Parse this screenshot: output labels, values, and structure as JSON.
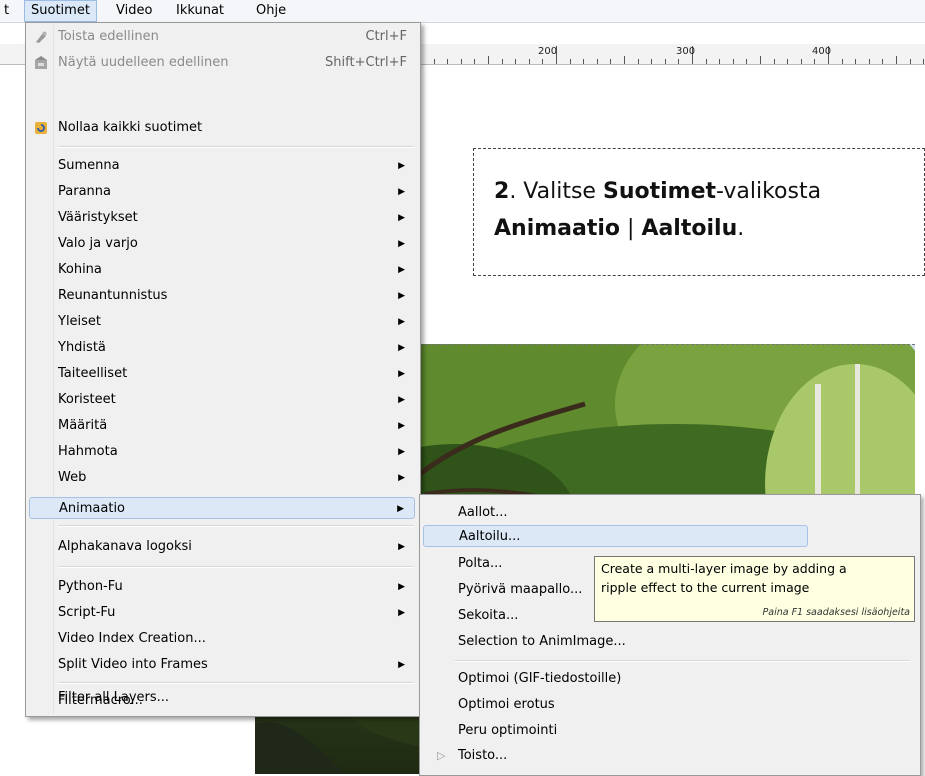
{
  "menubar": {
    "items": [
      {
        "label": "t"
      },
      {
        "label": "Suotimet"
      },
      {
        "label": "Video"
      },
      {
        "label": "Ikkunat"
      },
      {
        "label": "Ohje"
      }
    ]
  },
  "ruler": {
    "labels": [
      "200",
      "300",
      "400"
    ]
  },
  "callout": {
    "step": "2",
    "t1": ". Valitse ",
    "b1": "Suotimet",
    "t2": "-valikosta",
    "b2": "Animaatio",
    "sep": " | ",
    "b3": "Aaltoilu",
    "end": "."
  },
  "filters_menu": {
    "items": [
      {
        "label": "Toista edellinen",
        "shortcut": "Ctrl+F",
        "icon": "repeat-filter-icon",
        "disabled": true
      },
      {
        "label": "Näytä uudelleen edellinen",
        "shortcut": "Shift+Ctrl+F",
        "icon": "reshow-filter-icon",
        "disabled": true
      },
      {
        "label": "Nollaa kaikki suotimet",
        "icon": "reset-filters-icon"
      },
      {
        "label": "Sumenna"
      },
      {
        "label": "Paranna"
      },
      {
        "label": "Vääristykset"
      },
      {
        "label": "Valo ja varjo"
      },
      {
        "label": "Kohina"
      },
      {
        "label": "Reunantunnistus"
      },
      {
        "label": "Yleiset"
      },
      {
        "label": "Yhdistä"
      },
      {
        "label": "Taiteelliset"
      },
      {
        "label": "Koristeet"
      },
      {
        "label": "Määritä"
      },
      {
        "label": "Hahmota"
      },
      {
        "label": "Web"
      },
      {
        "label": "Animaatio"
      },
      {
        "label": "Alphakanava logoksi"
      },
      {
        "label": "Python-Fu"
      },
      {
        "label": "Script-Fu"
      },
      {
        "label": "Video Index Creation..."
      },
      {
        "label": "Split Video into Frames"
      },
      {
        "label": "Filter all Layers..."
      },
      {
        "label": "Filtermacro..."
      }
    ]
  },
  "animation_submenu": {
    "items": [
      {
        "label": "Aallot..."
      },
      {
        "label": "Aaltoilu..."
      },
      {
        "label": "Polta..."
      },
      {
        "label": "Pyörivä maapallo..."
      },
      {
        "label": "Sekoita..."
      },
      {
        "label": "Selection to AnimImage..."
      },
      {
        "label": "Optimoi (GIF-tiedostoille)"
      },
      {
        "label": "Optimoi erotus"
      },
      {
        "label": "Peru optimointi"
      },
      {
        "label": "Toisto..."
      }
    ]
  },
  "tooltip": {
    "line1": "Create a multi-layer image by adding a",
    "line2": "ripple effect to the current image",
    "hint": "Paina F1 saadaksesi lisäohjeita"
  },
  "colors": {
    "highlight": "#dce8f5",
    "tooltip_bg": "#ffffe1",
    "menu_bg": "#f0f0f0"
  }
}
